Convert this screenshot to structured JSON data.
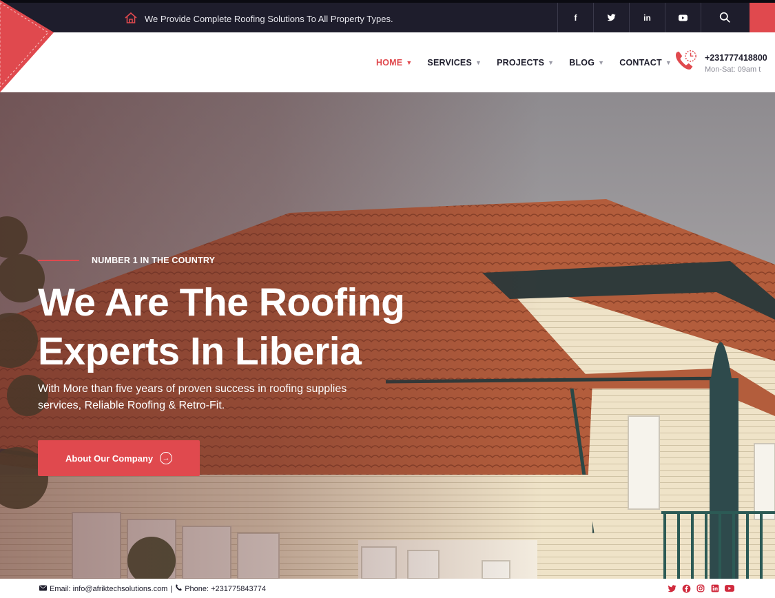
{
  "topbar": {
    "tagline": "We Provide Complete Roofing Solutions To All Property Types.",
    "social": [
      "f",
      "twitter",
      "in",
      "youtube"
    ]
  },
  "nav": {
    "items": [
      {
        "label": "HOME",
        "active": true
      },
      {
        "label": "SERVICES",
        "active": false
      },
      {
        "label": "PROJECTS",
        "active": false
      },
      {
        "label": "BLOG",
        "active": false
      },
      {
        "label": "CONTACT",
        "active": false
      }
    ],
    "phone": "+231777418800",
    "hours": "Mon-Sat: 09am t"
  },
  "hero": {
    "eyebrow": "NUMBER 1 IN THE COUNTRY",
    "title_line1": "We Are The Roofing",
    "title_line2": "Experts In Liberia",
    "lead_line1": "With More than five years of proven success in roofing supplies",
    "lead_line2": "services, Reliable Roofing & Retro-Fit.",
    "cta": "About Our Company"
  },
  "footer": {
    "email": "Email: info@afriktechsolutions.com",
    "separator": "|",
    "phone": "Phone: +231775843774",
    "icons": [
      "twitter-icon",
      "facebook-icon",
      "instagram-icon",
      "linkedin-icon",
      "youtube-icon"
    ]
  },
  "colors": {
    "accent": "#e0494e",
    "dark": "#1e1d2c",
    "roof": "#b35d3c"
  }
}
